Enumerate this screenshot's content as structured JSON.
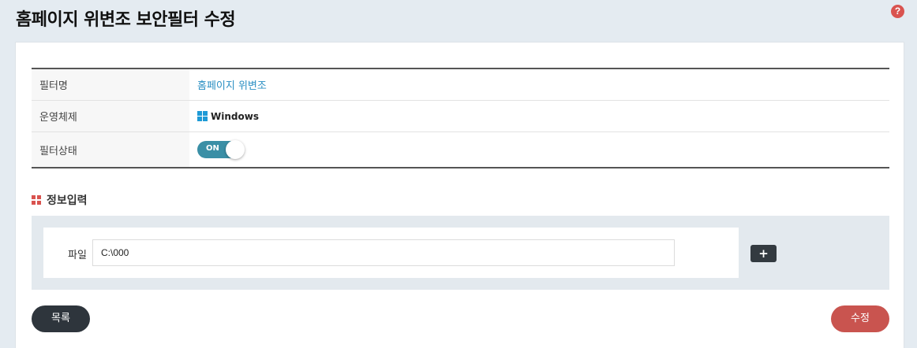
{
  "page": {
    "title": "홈페이지 위변조 보안필터 수정",
    "help_icon": "?"
  },
  "info": {
    "rows": [
      {
        "label": "필터명",
        "value": "홈페이지 위변조"
      },
      {
        "label": "운영체제",
        "value": "Windows",
        "icon": "windows-icon"
      },
      {
        "label": "필터상태",
        "toggle_label": "ON",
        "toggle_on": true
      }
    ]
  },
  "section": {
    "title": "정보입력",
    "icon": "grid-icon"
  },
  "form": {
    "file_label": "파일",
    "file_value": "C:\\000",
    "add_label": "+"
  },
  "buttons": {
    "list_label": "목록",
    "save_label": "수정"
  },
  "colors": {
    "accent_link": "#2b8fc3",
    "toggle_on": "#3a8fa6",
    "primary_red": "#c9544f",
    "dark_button": "#2e353c"
  }
}
